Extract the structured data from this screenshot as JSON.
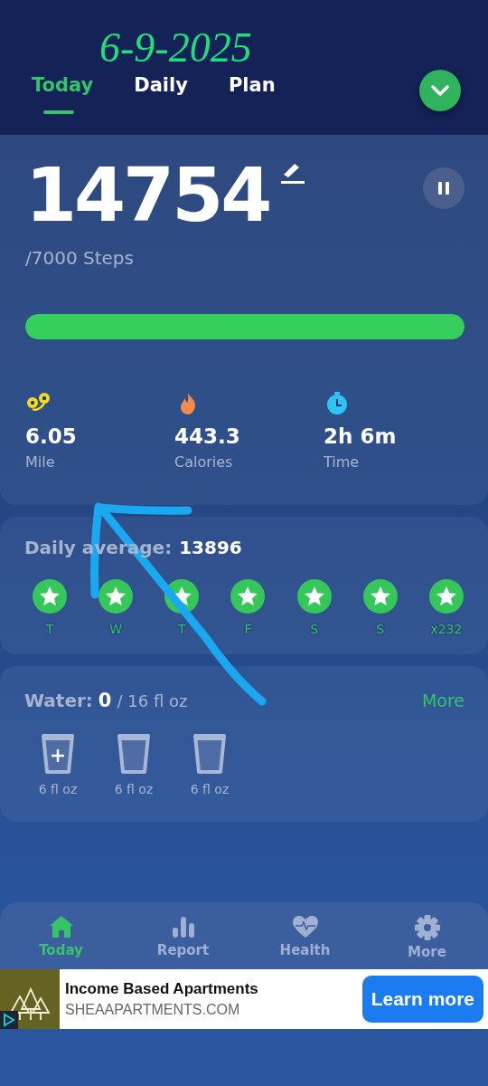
{
  "date_note": "6-9-2025",
  "tabs": [
    {
      "label": "Today",
      "selected": true
    },
    {
      "label": "Daily",
      "selected": false
    },
    {
      "label": "Plan",
      "selected": false
    }
  ],
  "steps": {
    "count": "14754",
    "goal": "/7000 Steps",
    "level": 1
  },
  "stats": [
    {
      "kind": "distance",
      "value": "6.05",
      "label": "Mile"
    },
    {
      "kind": "calories",
      "value": "443.3",
      "label": "Calories"
    },
    {
      "kind": "time",
      "value": "2h 6m",
      "label": "Time"
    }
  ],
  "daily_average": {
    "label": "Daily average:",
    "value": "13896"
  },
  "days": [
    {
      "label": "T",
      "achieved": true
    },
    {
      "label": "W",
      "achieved": true
    },
    {
      "label": "T",
      "achieved": true
    },
    {
      "label": "F",
      "achieved": true
    },
    {
      "label": "S",
      "achieved": true
    },
    {
      "label": "S",
      "achieved": true
    },
    {
      "label": "x232",
      "achieved": true
    }
  ],
  "water": {
    "label": "Water:",
    "amount": "0",
    "goal": "/ 16 fl oz",
    "more": "More",
    "cups": [
      {
        "label": "6 fl oz",
        "add": true
      },
      {
        "label": "6 fl oz",
        "add": false
      },
      {
        "label": "6 fl oz",
        "add": false
      }
    ]
  },
  "nav": [
    {
      "kind": "home",
      "label": "Today",
      "selected": true
    },
    {
      "kind": "report",
      "label": "Report",
      "selected": false
    },
    {
      "kind": "health",
      "label": "Health",
      "selected": false
    },
    {
      "kind": "settings",
      "label": "More",
      "selected": false
    }
  ],
  "ad": {
    "title": "Income Based Apartments",
    "domain": "SHEAAPARTMENTS.COM",
    "button": "Learn more"
  }
}
